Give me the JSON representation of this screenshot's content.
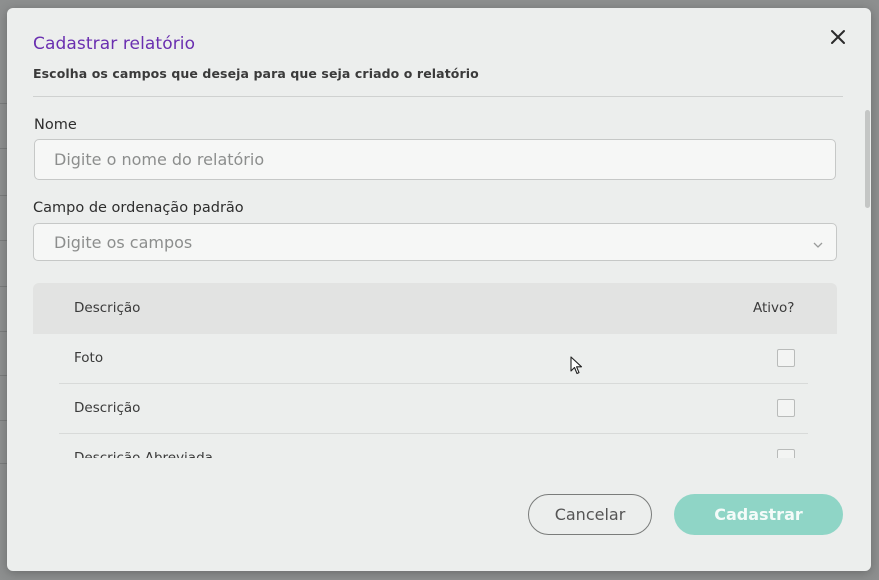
{
  "modal": {
    "title": "Cadastrar relatório",
    "subtitle": "Escolha os campos que deseja para que seja criado o relatório",
    "close_icon": "close-icon"
  },
  "form": {
    "name_label": "Nome",
    "name_placeholder": "Digite o nome do relatório",
    "name_value": "",
    "order_label": "Campo de ordenação padrão",
    "order_placeholder": "Digite os campos"
  },
  "table": {
    "headers": {
      "description": "Descrição",
      "active": "Ativo?"
    },
    "rows": [
      {
        "label": "Foto",
        "active": false
      },
      {
        "label": "Descrição",
        "active": false
      },
      {
        "label": "Descrição Abreviada",
        "active": false
      }
    ]
  },
  "actions": {
    "cancel_label": "Cancelar",
    "submit_label": "Cadastrar"
  },
  "colors": {
    "title": "#6a2fb0",
    "submit_button": "#8fd5c6"
  }
}
